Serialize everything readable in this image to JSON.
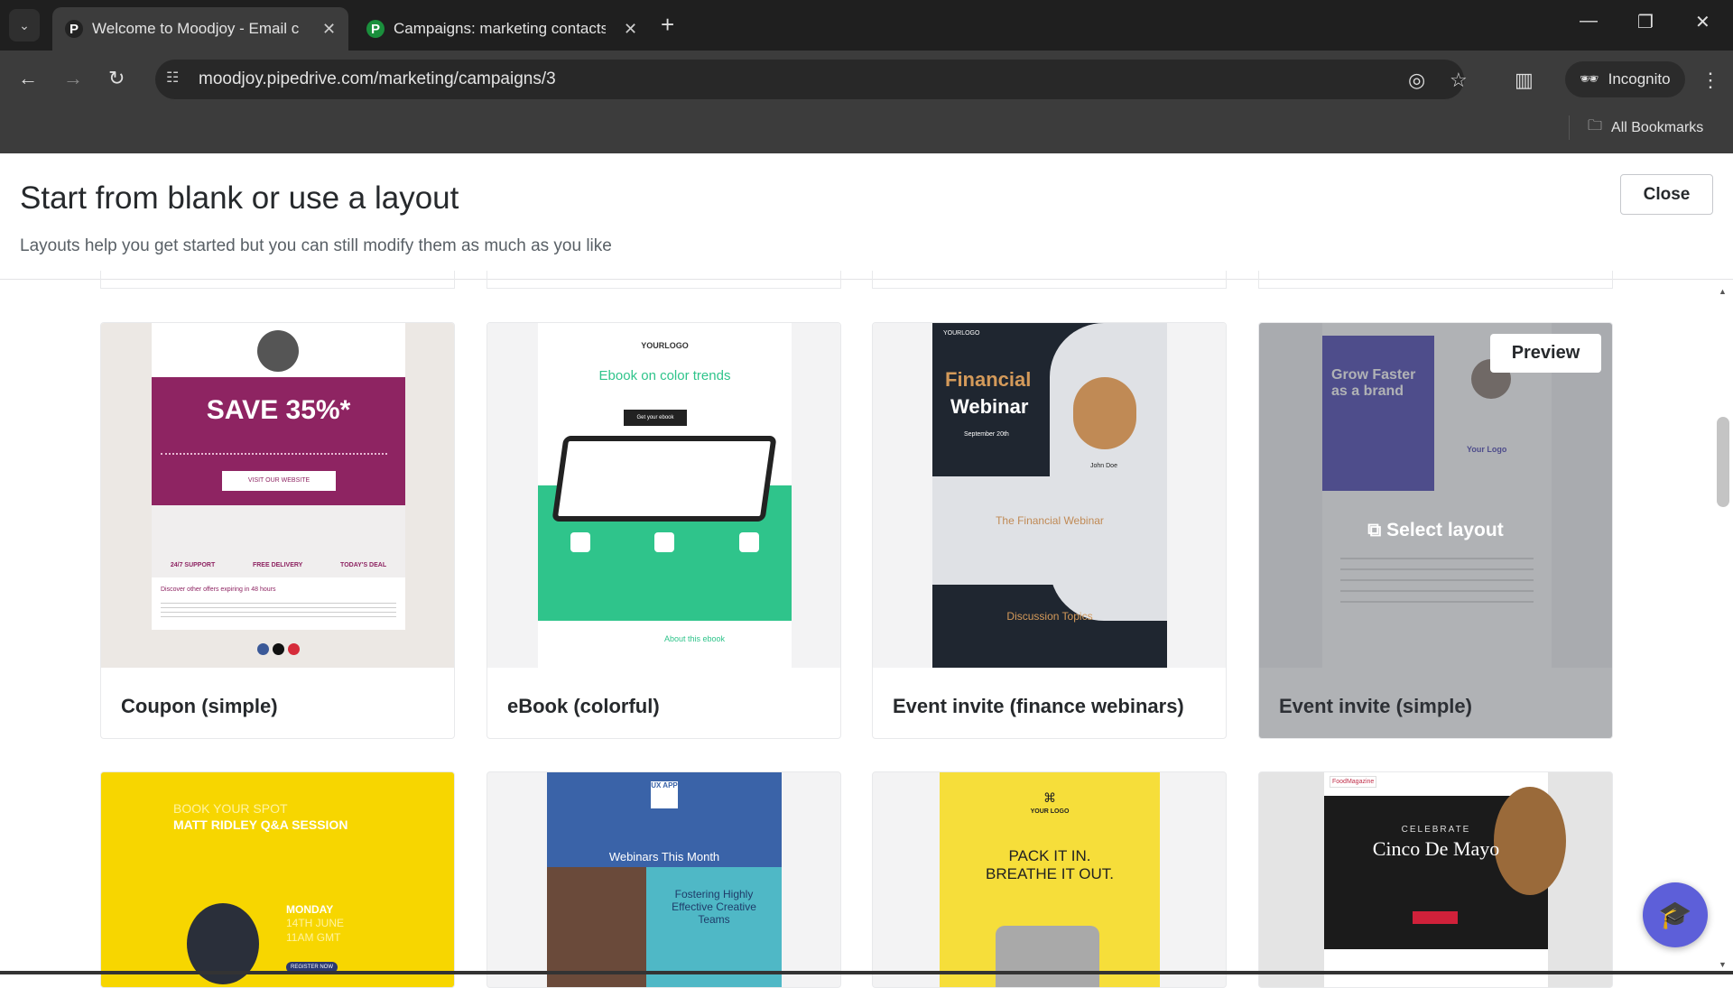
{
  "browser": {
    "tabs": [
      {
        "title": "Welcome to Moodjoy - Email c",
        "favicon": "P",
        "active": true
      },
      {
        "title": "Campaigns: marketing contacts",
        "favicon": "P",
        "active": false
      }
    ],
    "url": "moodjoy.pipedrive.com/marketing/campaigns/3",
    "incognito_label": "Incognito",
    "bookmarks_label": "All Bookmarks"
  },
  "modal": {
    "title": "Start from blank or use a layout",
    "subtitle": "Layouts help you get started but you can still modify them as much as you like",
    "close_label": "Close"
  },
  "hover": {
    "preview_label": "Preview",
    "select_label": "Select layout"
  },
  "layouts": [
    {
      "name": "Coupon (simple)",
      "headline": "SAVE 35%*",
      "button": "VISIT OUR WEBSITE",
      "features": [
        "24/7 SUPPORT",
        "FREE DELIVERY",
        "TODAY'S DEAL"
      ],
      "body": "Discover other offers expiring in 48 hours",
      "color": "#8e2462"
    },
    {
      "name": "eBook (colorful)",
      "logo": "YOURLOGO",
      "headline": "Ebook on color trends",
      "button": "Get your ebook",
      "section": "About this ebook",
      "color": "#2fc48b"
    },
    {
      "name": "Event invite (finance webinars)",
      "logo": "YOURLOGO",
      "headline1": "Financial",
      "headline2": "Webinar",
      "date": "September 20th",
      "speaker": "John Doe",
      "section1": "The Financial Webinar",
      "section2": "Discussion Topics",
      "color": "#1f2630"
    },
    {
      "name": "Event invite (simple)",
      "headline": "Grow Faster as a brand",
      "logo": "Your Logo",
      "color": "#4e47b3"
    },
    {
      "headline1": "BOOK YOUR SPOT",
      "headline2": "MATT RIDLEY Q&A SESSION",
      "date1": "MONDAY",
      "date2": "14TH JUNE",
      "date3": "11AM GMT",
      "button": "REGISTER NOW",
      "color": "#f7d600"
    },
    {
      "logo": "UX APP",
      "headline": "Webinars This Month",
      "feature": "Fostering Highly Effective Creative Teams",
      "color": "#3a63a8"
    },
    {
      "logo": "YOUR LOGO",
      "headline1": "PACK IT IN.",
      "headline2": "BREATHE IT OUT.",
      "color": "#f6de3a"
    },
    {
      "logo": "FoodMagazine",
      "headline1": "CELEBRATE",
      "headline2": "Cinco De Mayo",
      "color": "#1b1b1b"
    }
  ]
}
